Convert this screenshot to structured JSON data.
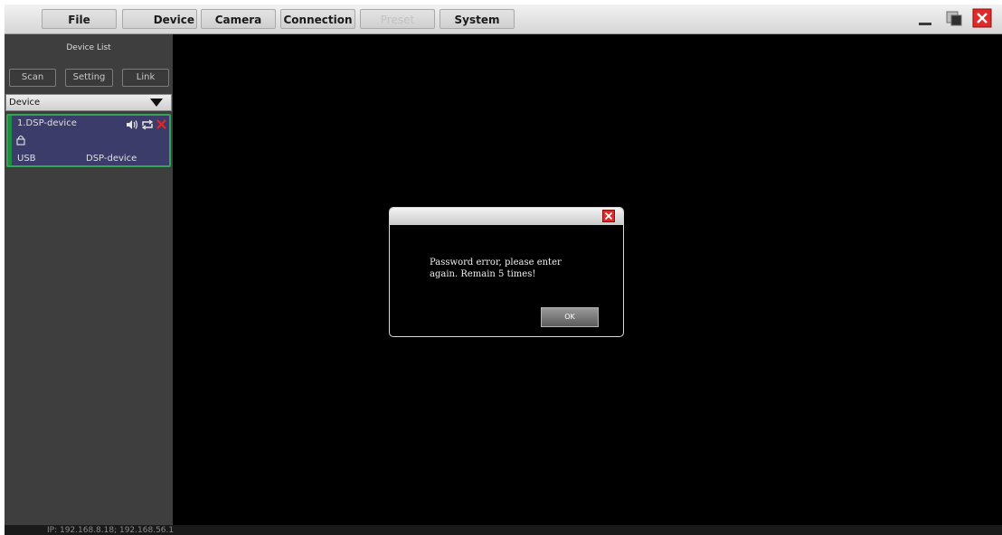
{
  "menubar": {
    "items": [
      {
        "label": "File",
        "enabled": true
      },
      {
        "label": "Device",
        "enabled": true
      },
      {
        "label": "Camera",
        "enabled": true
      },
      {
        "label": "Connection",
        "enabled": true
      },
      {
        "label": "Preset",
        "enabled": false
      },
      {
        "label": "System",
        "enabled": true
      }
    ]
  },
  "sidebar": {
    "title": "Device List",
    "buttons": {
      "scan": "Scan",
      "setting": "Setting",
      "link": "Link"
    },
    "dropdown": {
      "selected": "Device"
    },
    "device_card": {
      "name": "1.DSP-device",
      "interface": "USB",
      "model": "DSP-device"
    }
  },
  "status_bar": {
    "ip": "IP: 192.168.8.18; 192.168.56.1"
  },
  "dialog": {
    "message_line1": "Password error, please enter",
    "message_line2": "again. Remain 5 times!",
    "ok_label": "OK"
  },
  "colors": {
    "accent_green": "#38a354",
    "close_red": "#e02a2a",
    "card_bg": "#3c3c6b"
  }
}
